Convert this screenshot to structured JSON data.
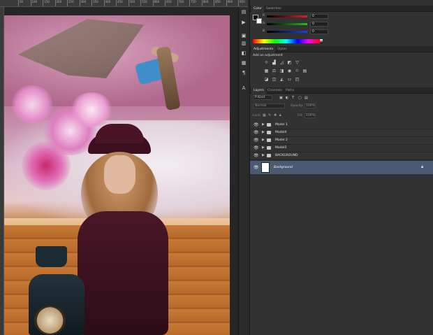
{
  "ruler": {
    "ticks": [
      "50",
      "100",
      "150",
      "200",
      "250",
      "300",
      "350",
      "400",
      "450",
      "500",
      "550",
      "600",
      "650",
      "700",
      "750",
      "800",
      "850",
      "900",
      "950"
    ]
  },
  "tools": {
    "items": [
      "move-tool-icon",
      "play-icon",
      "actions-icon",
      "brush-preset-icon",
      "adjust-icon",
      "clone-icon",
      "paragraph-icon",
      "type-icon"
    ]
  },
  "color_panel": {
    "tabs": [
      "Color",
      "Swatches"
    ],
    "channels": [
      {
        "label": "R",
        "value": "0",
        "color": "#c23a3a"
      },
      {
        "label": "G",
        "value": "0",
        "color": "#3aa23a"
      },
      {
        "label": "B",
        "value": "0",
        "color": "#3a4ac2"
      }
    ]
  },
  "adjustments_panel": {
    "tabs": [
      "Adjustments",
      "Styles"
    ],
    "heading": "Add an adjustment"
  },
  "layers_panel": {
    "tabs": [
      "Layers",
      "Channels",
      "Paths"
    ],
    "filter": "P Kind",
    "blend_mode": "Normal",
    "opacity_label": "Opacity:",
    "opacity_value": "100%",
    "lock_label": "Lock:",
    "fill_label": "Fill:",
    "fill_value": "100%",
    "layers": [
      {
        "name": "Model 1",
        "type": "group"
      },
      {
        "name": "Model4",
        "type": "group"
      },
      {
        "name": "Model 2",
        "type": "group"
      },
      {
        "name": "Model3",
        "type": "group"
      },
      {
        "name": "BACKGROUND",
        "type": "group"
      }
    ],
    "background_layer": "Background"
  }
}
